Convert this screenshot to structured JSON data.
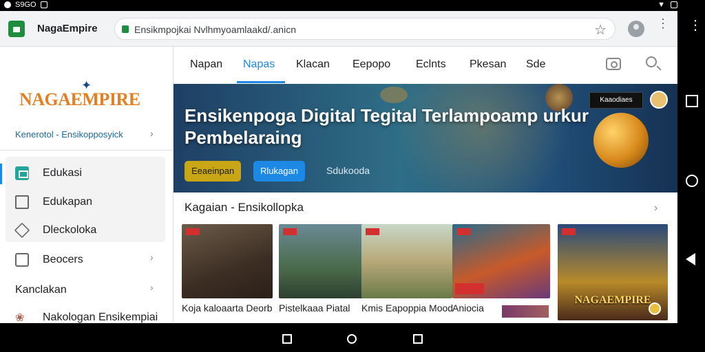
{
  "status_bar": {
    "left_text": "S9GO"
  },
  "browser": {
    "site_title": "NagaEmpire",
    "url": "Ensikmpojkai Nvlhmyoamlaakd/.anicn"
  },
  "sidebar": {
    "logo": "NAGAEMPIRE",
    "breadcrumb": "Kenerotol - Ensikopposyick",
    "items": [
      {
        "label": "Edukasi"
      },
      {
        "label": "Edukapan"
      },
      {
        "label": "Dleckoloka"
      },
      {
        "label": "Beocers"
      },
      {
        "label": "Kanclakan"
      },
      {
        "label": "Nakologan Ensikempiai"
      }
    ]
  },
  "nav": {
    "tabs": [
      {
        "label": "Napan"
      },
      {
        "label": "Napas"
      },
      {
        "label": "Klacan"
      },
      {
        "label": "Eepopo"
      },
      {
        "label": "Eclnts"
      },
      {
        "label": "Pkesan"
      },
      {
        "label": "Sde"
      }
    ]
  },
  "hero": {
    "title": "Ensikenpoga Digital Tegital Terlampoamp urkur Pembelaraing",
    "badge": "Kaaodiaes",
    "button_primary": "Eeaeinpan",
    "button_secondary": "Rlukagan",
    "link": "Sdukooda"
  },
  "section": {
    "title": "Kagaian - Ensikollopka"
  },
  "cards": [
    {
      "title": "Koja kaloaarta Deorbier"
    },
    {
      "title": "Pistelkaaa Piatal"
    },
    {
      "title": "Kmis Eapoppia Moodaloi"
    },
    {
      "title": "Aniocia"
    },
    {
      "title": "NAGAEMPIRE"
    }
  ],
  "colors": {
    "accent": "#1e88e5",
    "brand": "#e67e22",
    "yellow_button": "#c9a616"
  }
}
